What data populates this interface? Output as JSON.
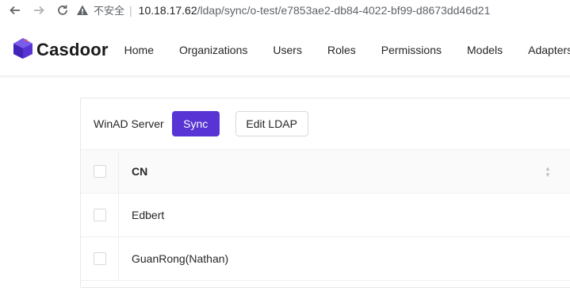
{
  "browser": {
    "insecure_label": "不安全",
    "separator": "|",
    "host": "10.18.17.62",
    "path": "/ldap/sync/o-test/e7853ae2-db84-4022-bf99-d8673dd46d21"
  },
  "header": {
    "brand": "Casdoor",
    "menu": [
      "Home",
      "Organizations",
      "Users",
      "Roles",
      "Permissions",
      "Models",
      "Adapters"
    ]
  },
  "card": {
    "title": "WinAD Server",
    "sync_label": "Sync",
    "edit_label": "Edit LDAP"
  },
  "table": {
    "column": "CN",
    "rows": [
      "Edbert",
      "GuanRong(Nathan)"
    ]
  },
  "colors": {
    "accent": "#5734d3"
  }
}
